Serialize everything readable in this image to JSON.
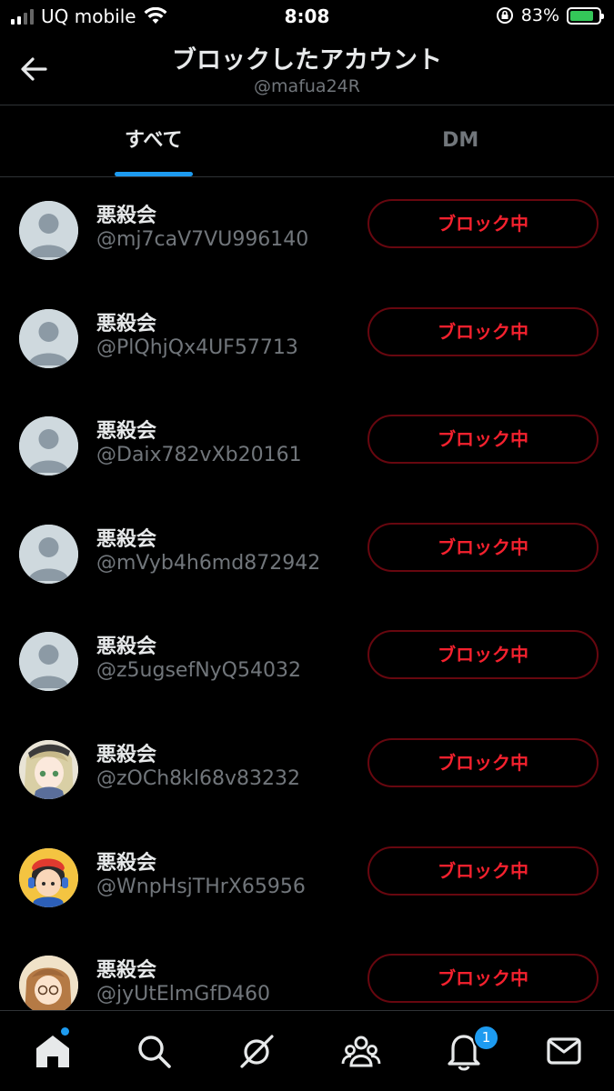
{
  "status_bar": {
    "carrier": "UQ mobile",
    "time": "8:08",
    "battery_percent": "83%",
    "battery_level": 0.83
  },
  "header": {
    "title": "ブロックしたアカウント",
    "subtitle": "@mafua24R"
  },
  "tabs": [
    {
      "label": "すべて",
      "active": true
    },
    {
      "label": "DM",
      "active": false
    }
  ],
  "accounts": [
    {
      "name": "悪殺会",
      "handle": "@mj7caV7VU996140",
      "button": "ブロック中",
      "avatar": "default-avatar-icon"
    },
    {
      "name": "悪殺会",
      "handle": "@PlQhjQx4UF57713",
      "button": "ブロック中",
      "avatar": "default-avatar-icon"
    },
    {
      "name": "悪殺会",
      "handle": "@Daix782vXb20161",
      "button": "ブロック中",
      "avatar": "default-avatar-icon"
    },
    {
      "name": "悪殺会",
      "handle": "@mVyb4h6md872942",
      "button": "ブロック中",
      "avatar": "default-avatar-icon"
    },
    {
      "name": "悪殺会",
      "handle": "@z5ugsefNyQ54032",
      "button": "ブロック中",
      "avatar": "default-avatar-icon"
    },
    {
      "name": "悪殺会",
      "handle": "@zOCh8kl68v83232",
      "button": "ブロック中",
      "avatar": "anime-girl-avatar"
    },
    {
      "name": "悪殺会",
      "handle": "@WnpHsjTHrX65956",
      "button": "ブロック中",
      "avatar": "boy-headphones-avatar"
    },
    {
      "name": "悪殺会",
      "handle": "@jyUtElmGfD460",
      "button": "ブロック中",
      "avatar": "girl-glasses-avatar"
    }
  ],
  "bottom_nav": {
    "items": [
      "home-icon",
      "search-icon",
      "spaces-icon",
      "communities-icon",
      "notifications-icon",
      "messages-icon"
    ],
    "notification_count": "1"
  },
  "colors": {
    "accent": "#1d9bf0",
    "block_red": "#f4212e",
    "block_border": "#67070f",
    "text_secondary": "#71767b"
  }
}
